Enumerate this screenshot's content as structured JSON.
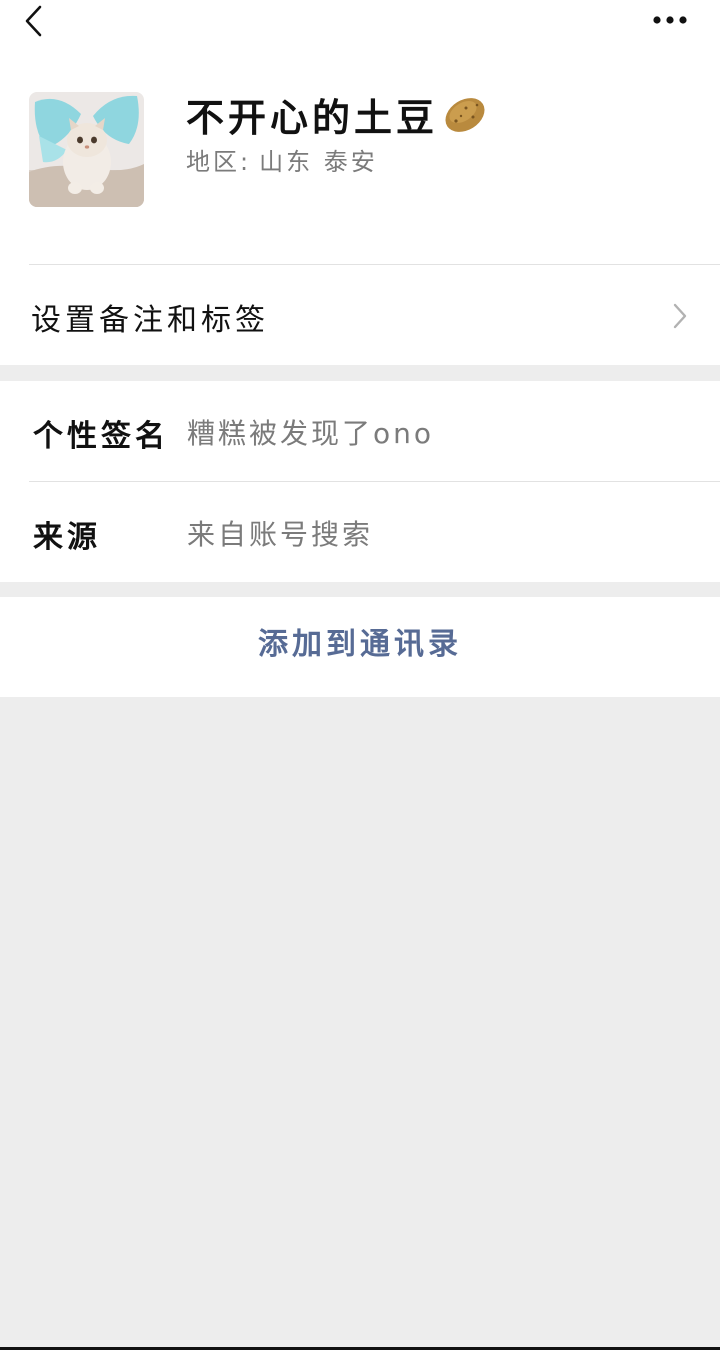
{
  "profile": {
    "nickname": "不开心的土豆",
    "region_label": "地区:",
    "region_value": "山东 泰安"
  },
  "remark_row": {
    "label": "设置备注和标签"
  },
  "info": {
    "signature_label": "个性签名",
    "signature_value": "糟糕被发现了ono",
    "source_label": "来源",
    "source_value": "来自账号搜索"
  },
  "actions": {
    "add_to_contacts": "添加到通讯录"
  },
  "icons": {
    "back": "chevron-left-icon",
    "more": "more-dots-icon",
    "potato": "potato-emoji-icon",
    "chevron_right": "chevron-right-icon"
  },
  "colors": {
    "link": "#576b95",
    "secondary_text": "#7b7b7b",
    "page_bg": "#ededed"
  }
}
